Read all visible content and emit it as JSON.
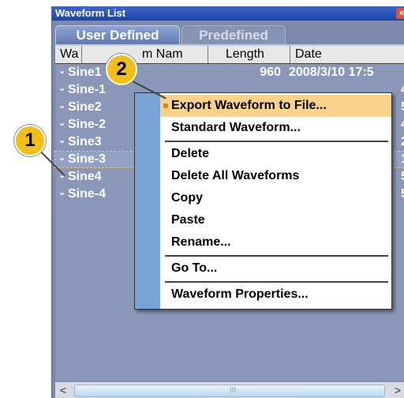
{
  "window": {
    "title": "Waveform List",
    "close_label": "×"
  },
  "tabs": [
    {
      "label": "User Defined",
      "active": true
    },
    {
      "label": "Predefined",
      "active": false
    }
  ],
  "columns": {
    "name": "Waveform Name",
    "name_visible_a": "Wa",
    "name_visible_b": "m Nam",
    "length": "Length",
    "date": "Date"
  },
  "rows": [
    {
      "name": "Sine1",
      "length": "960",
      "date": "2008/3/10 17:5"
    },
    {
      "name": "Sine-1",
      "length": "",
      "date": "4"
    },
    {
      "name": "Sine2",
      "length": "",
      "date": "5"
    },
    {
      "name": "Sine-2",
      "length": "",
      "date": "4"
    },
    {
      "name": "Sine3",
      "length": "",
      "date": "2"
    },
    {
      "name": "Sine-3",
      "length": "",
      "date": "1"
    },
    {
      "name": "Sine4",
      "length": "",
      "date": "5"
    },
    {
      "name": "Sine-4",
      "length": "",
      "date": "5"
    }
  ],
  "context_menu": {
    "items": [
      "Export Waveform to File...",
      "Standard Waveform...",
      "Delete",
      "Delete All Waveforms",
      "Copy",
      "Paste",
      "Rename...",
      "Go To...",
      "Waveform Properties..."
    ]
  },
  "callouts": {
    "one": "1",
    "two": "2"
  },
  "scrollbar": {
    "left": "<",
    "right": ">",
    "grip": "III"
  },
  "colors": {
    "highlight": "#fbd28b",
    "callout": "#f2be1a",
    "menu_strip": "#7ba4d6"
  }
}
